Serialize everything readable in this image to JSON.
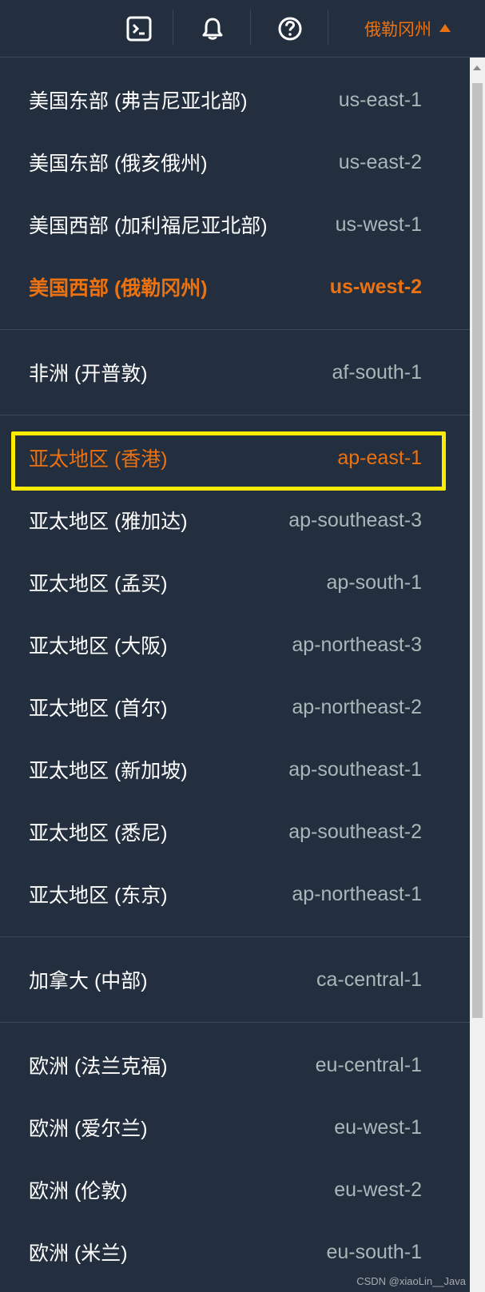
{
  "topbar": {
    "icons": [
      "cloudshell-icon",
      "bell-icon",
      "help-icon"
    ],
    "region_label": "俄勒冈州"
  },
  "colors": {
    "background": "#232f3e",
    "accent": "#ec7211",
    "highlight_box": "#ffeb00",
    "muted": "#aab7b8"
  },
  "menu": {
    "groups": [
      {
        "items": [
          {
            "name": "美国东部 (弗吉尼亚北部)",
            "code": "us-east-1"
          },
          {
            "name": "美国东部 (俄亥俄州)",
            "code": "us-east-2"
          },
          {
            "name": "美国西部 (加利福尼亚北部)",
            "code": "us-west-1"
          },
          {
            "name": "美国西部 (俄勒冈州)",
            "code": "us-west-2",
            "selected": true
          }
        ]
      },
      {
        "items": [
          {
            "name": "非洲 (开普敦)",
            "code": "af-south-1"
          }
        ]
      },
      {
        "items": [
          {
            "name": "亚太地区 (香港)",
            "code": "ap-east-1",
            "highlighted": true
          },
          {
            "name": "亚太地区 (雅加达)",
            "code": "ap-southeast-3"
          },
          {
            "name": "亚太地区 (孟买)",
            "code": "ap-south-1"
          },
          {
            "name": "亚太地区 (大阪)",
            "code": "ap-northeast-3"
          },
          {
            "name": "亚太地区 (首尔)",
            "code": "ap-northeast-2"
          },
          {
            "name": "亚太地区 (新加坡)",
            "code": "ap-southeast-1"
          },
          {
            "name": "亚太地区 (悉尼)",
            "code": "ap-southeast-2"
          },
          {
            "name": "亚太地区 (东京)",
            "code": "ap-northeast-1"
          }
        ]
      },
      {
        "items": [
          {
            "name": "加拿大 (中部)",
            "code": "ca-central-1"
          }
        ]
      },
      {
        "items": [
          {
            "name": "欧洲 (法兰克福)",
            "code": "eu-central-1"
          },
          {
            "name": "欧洲 (爱尔兰)",
            "code": "eu-west-1"
          },
          {
            "name": "欧洲 (伦敦)",
            "code": "eu-west-2"
          },
          {
            "name": "欧洲 (米兰)",
            "code": "eu-south-1"
          }
        ]
      }
    ]
  },
  "watermark": "CSDN @xiaoLin__Java"
}
